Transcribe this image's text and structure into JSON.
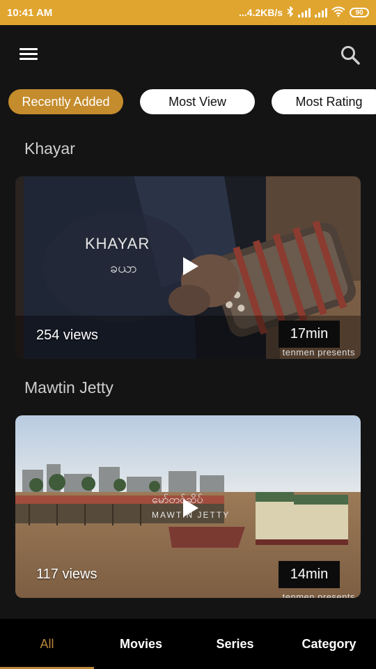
{
  "status": {
    "time": "10:41 AM",
    "speed": "...4.2KB/s",
    "battery": "90",
    "bluetooth_icon": "bluetooth-icon",
    "wifi_icon": "wifi-icon"
  },
  "appbar": {
    "menu_icon": "menu-icon",
    "search_icon": "search-icon"
  },
  "filters": [
    {
      "label": "Recently Added",
      "active": true
    },
    {
      "label": "Most View",
      "active": false
    },
    {
      "label": "Most Rating",
      "active": false
    }
  ],
  "items": [
    {
      "title": "Khayar",
      "overlay_title": "KHAYAR",
      "overlay_sub": "ခယာ",
      "views": "254 views",
      "duration": "17min",
      "presents": "tenmen presents"
    },
    {
      "title": "Mawtin Jetty",
      "overlay_title": "မော်တင်ဆိပ်",
      "overlay_sub": "MAWTIN JETTY",
      "views": "117 views",
      "duration": "14min",
      "presents": "tenmen presents"
    }
  ],
  "bottom_nav": [
    {
      "label": "All",
      "active": true
    },
    {
      "label": "Movies",
      "active": false
    },
    {
      "label": "Series",
      "active": false
    },
    {
      "label": "Category",
      "active": false
    }
  ],
  "colors": {
    "accent": "#e0a52f",
    "chip_active": "#c48c2c",
    "background": "#141414"
  }
}
